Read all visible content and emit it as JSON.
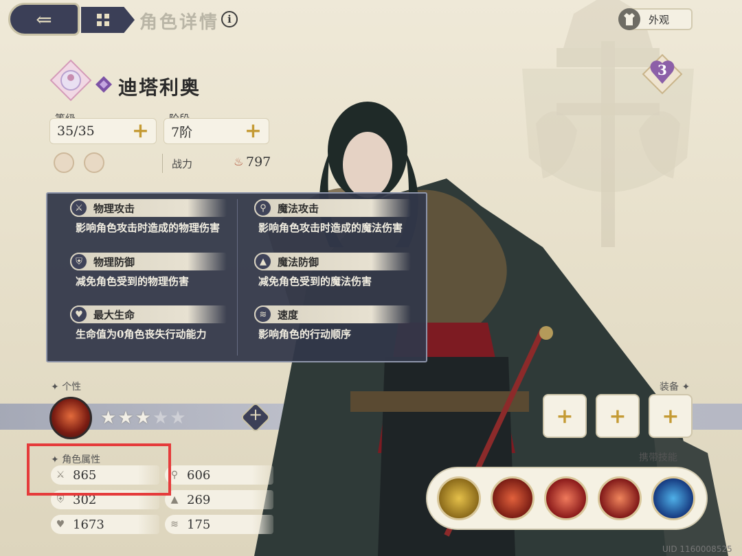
{
  "nav": {
    "back_icon": "back-arrow-icon",
    "menu_icon": "grid-menu-icon",
    "title": "角色详情",
    "info_icon": "i"
  },
  "appearance": {
    "label": "外观"
  },
  "rank_badge": {
    "value": "3"
  },
  "character": {
    "name": "迪塔利奥"
  },
  "level": {
    "label": "等级",
    "value": "35/35"
  },
  "tier": {
    "label": "阶段",
    "value": "7阶"
  },
  "power": {
    "label": "战力",
    "value": "797"
  },
  "tooltip": {
    "items": [
      {
        "title": "物理攻击",
        "icon": "sword-icon",
        "desc": "影响角色攻击时造成的物理伤害"
      },
      {
        "title": "魔法攻击",
        "icon": "wand-icon",
        "desc": "影响角色攻击时造成的魔法伤害"
      },
      {
        "title": "物理防御",
        "icon": "shield-icon",
        "desc": "减免角色受到的物理伤害"
      },
      {
        "title": "魔法防御",
        "icon": "wizard-hat-icon",
        "desc": "减免角色受到的魔法伤害"
      },
      {
        "title": "最大生命",
        "icon": "heart-icon",
        "desc": "生命值为0角色丧失行动能力"
      },
      {
        "title": "速度",
        "icon": "wing-icon",
        "desc": "影响角色的行动顺序"
      }
    ]
  },
  "personality": {
    "label": "个性",
    "stars_filled": 3,
    "stars_total": 5
  },
  "attributes": {
    "label": "角色属性",
    "physical_attack": "865",
    "magic_attack": "606",
    "physical_defense": "302",
    "magic_defense": "269",
    "max_hp": "1673",
    "speed": "175"
  },
  "equipment": {
    "label": "装备"
  },
  "skills": {
    "label": "携带技能"
  },
  "uid": "UID 1160008525",
  "colors": {
    "accent": "#c49a33",
    "panel": "#323749",
    "highlight": "#e53b3b"
  }
}
